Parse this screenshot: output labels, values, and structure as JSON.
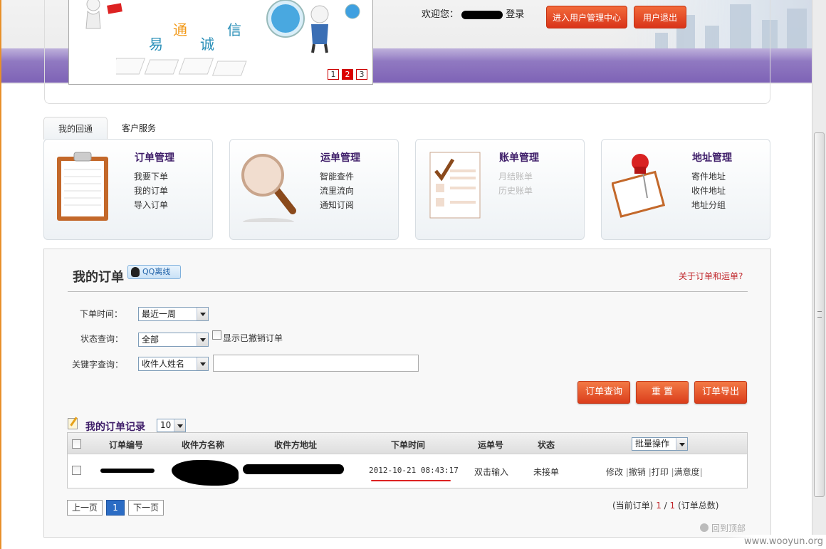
{
  "header": {
    "banner_words": [
      "易",
      "通",
      "诚",
      "信"
    ],
    "slides": [
      "1",
      "2",
      "3"
    ],
    "active_slide": "2",
    "welcome_prefix": "欢迎您：",
    "login_suffix": "登录",
    "user_center_button": "进入用户管理中心",
    "logout_button": "用户退出"
  },
  "tabs": [
    {
      "label": "我的回通",
      "active": true
    },
    {
      "label": "客户服务",
      "active": false
    }
  ],
  "cards": [
    {
      "title": "订单管理",
      "icon": "clipboard-icon",
      "links": [
        "我要下单",
        "我的订单",
        "导入订单"
      ],
      "disabled": false
    },
    {
      "title": "运单管理",
      "icon": "magnifier-icon",
      "links": [
        "智能查件",
        "流里流向",
        "通知订阅"
      ],
      "disabled": false
    },
    {
      "title": "账单管理",
      "icon": "checklist-icon",
      "links": [
        "月结账单",
        "历史账单"
      ],
      "disabled": true
    },
    {
      "title": "地址管理",
      "icon": "pushpin-icon",
      "links": [
        "寄件地址",
        "收件地址",
        "地址分组"
      ],
      "disabled": false
    }
  ],
  "orders": {
    "title": "我的订单",
    "qq_status": "QQ离线",
    "about_link": "关于订单和运单?",
    "filters": {
      "time_label": "下单时间：",
      "time_value": "最近一周",
      "status_label": "状态查询：",
      "status_value": "全部",
      "show_cancelled_label": "显示已撤销订单",
      "keyword_label": "关键字查询：",
      "keyword_type": "收件人姓名",
      "keyword_value": ""
    },
    "buttons": {
      "query": "订单查询",
      "reset": "重 置",
      "export": "订单导出"
    },
    "records_title": "我的订单记录",
    "page_size": "10",
    "columns": [
      "订单编号",
      "收件方名称",
      "收件方地址",
      "下单时间",
      "运单号",
      "状态"
    ],
    "batch_label": "批量操作",
    "rows": [
      {
        "order_time": "2012-10-21 08:43:17",
        "waybill": "双击输入",
        "status": "未接单",
        "actions": [
          "修改",
          "撤销",
          "打印",
          "满意度"
        ]
      }
    ],
    "pagination": {
      "prev": "上一页",
      "current": "1",
      "next": "下一页",
      "info_prefix": "(当前订单)",
      "current_count": "1",
      "sep": "/",
      "total_count": "1",
      "info_suffix": "(订单总数)"
    },
    "back_to_top": "回到顶部"
  },
  "watermark": "www.wooyun.org",
  "colors": {
    "accent_purple": "#3e1d69",
    "button_orange": "#db3e1c",
    "link_red": "#c0262b"
  }
}
